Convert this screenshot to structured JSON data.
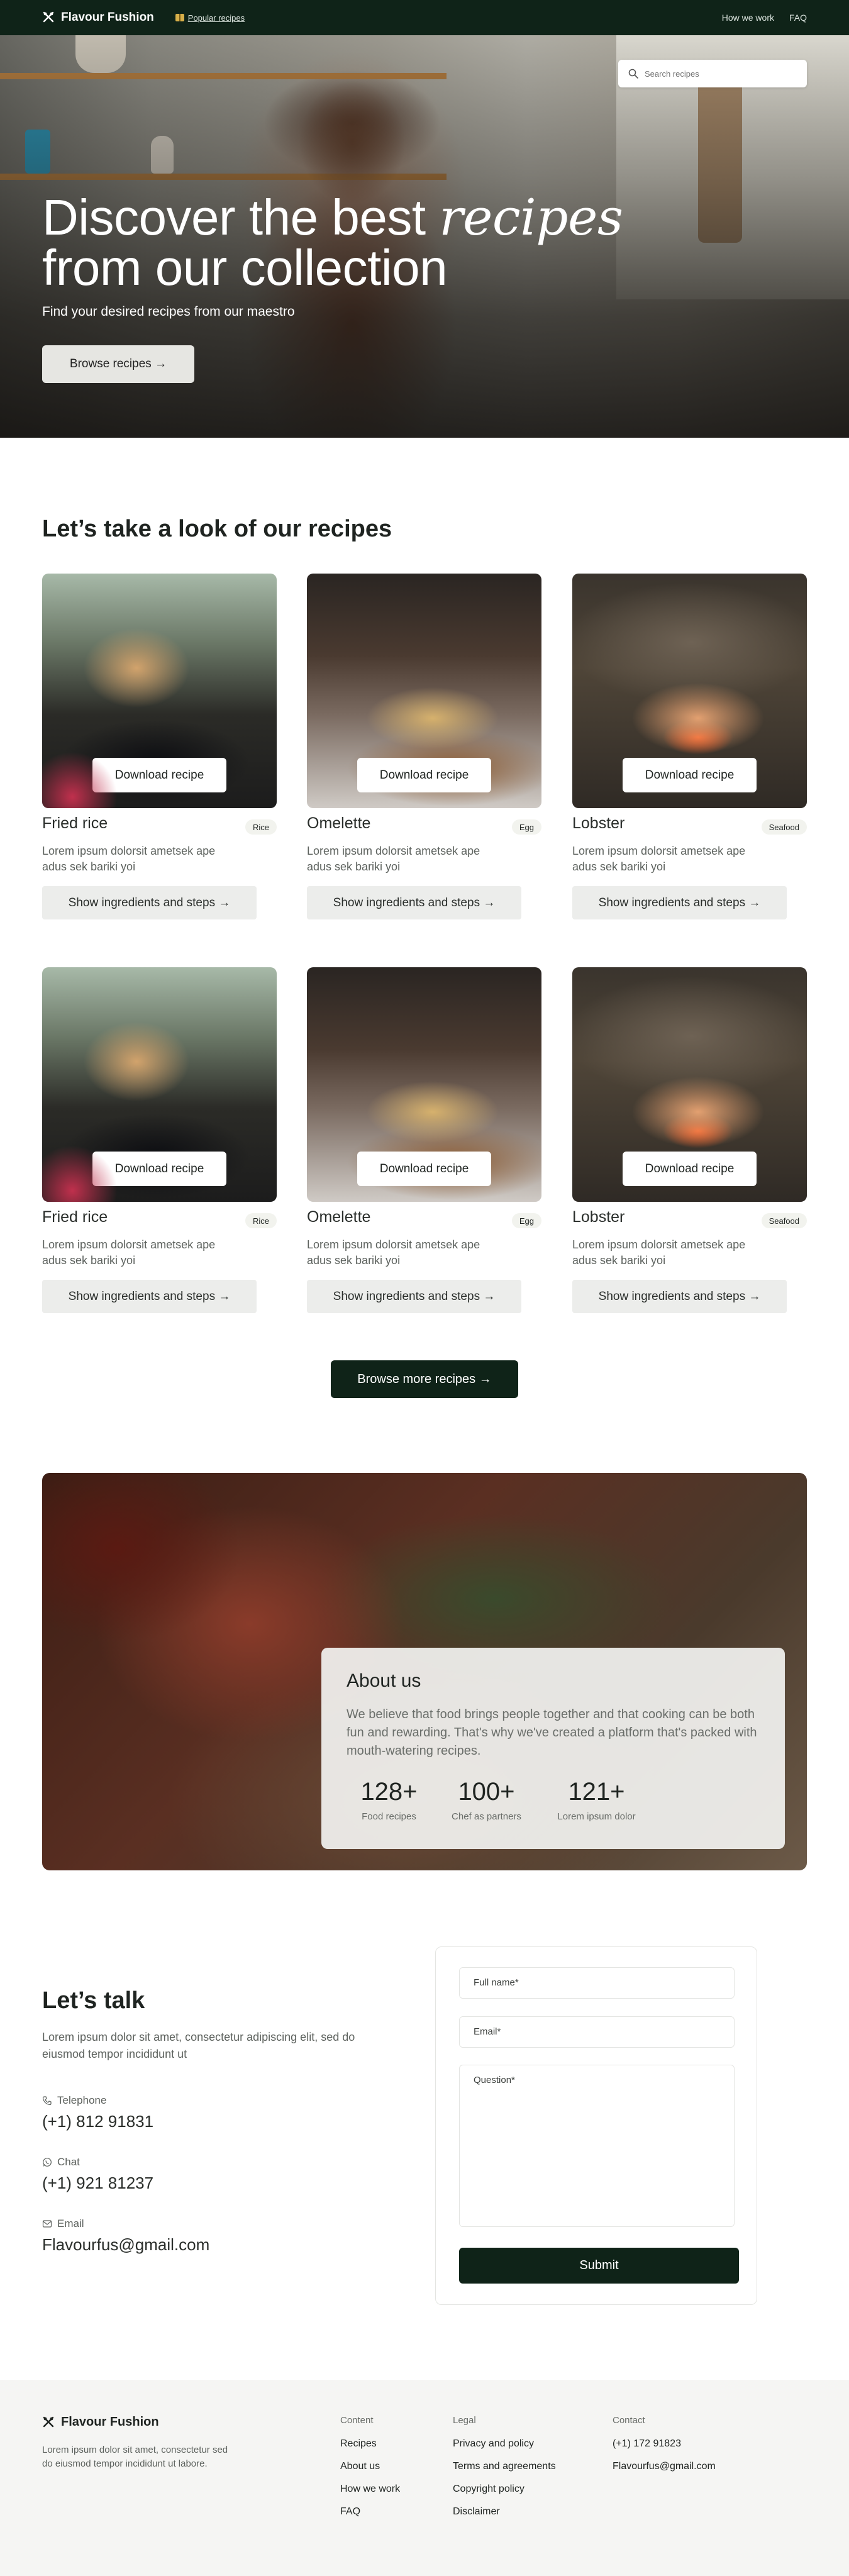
{
  "nav": {
    "brand": "Flavour Fushion",
    "popular": "Popular recipes",
    "links": [
      "How we work",
      "FAQ"
    ]
  },
  "hero": {
    "title_line1_plain": "Discover the best ",
    "title_line1_italic": "recipes",
    "title_line2": "from our collection",
    "subtitle": "Find your desired recipes from our maestro",
    "browse_button": "Browse recipes →",
    "search_placeholder": "Search recipes"
  },
  "recipes": {
    "section_title": "Let’s take a look of our recipes",
    "download_label": "Download recipe",
    "steps_label": "Show ingredients and steps →",
    "cards": [
      {
        "name": "Fried rice",
        "tag": "Rice",
        "desc": "Lorem ipsum dolorsit ametsek ape adus sek bariki yoi",
        "image": "fried-rice"
      },
      {
        "name": "Omelette",
        "tag": "Egg",
        "desc": "Lorem ipsum dolorsit ametsek ape adus sek bariki yoi",
        "image": "omelette"
      },
      {
        "name": "Lobster",
        "tag": "Seafood",
        "desc": "Lorem ipsum dolorsit ametsek ape adus sek bariki yoi",
        "image": "lobster"
      },
      {
        "name": "Fried rice",
        "tag": "Rice",
        "desc": "Lorem ipsum dolorsit ametsek ape adus sek bariki yoi",
        "image": "fried-rice"
      },
      {
        "name": "Omelette",
        "tag": "Egg",
        "desc": "Lorem ipsum dolorsit ametsek ape adus sek bariki yoi",
        "image": "omelette"
      },
      {
        "name": "Lobster",
        "tag": "Seafood",
        "desc": "Lorem ipsum dolorsit ametsek ape adus sek bariki yoi",
        "image": "lobster"
      }
    ],
    "more_button": "Browse more recipes →"
  },
  "about": {
    "title": "About us",
    "text": "We believe that food brings people together and that cooking can be both fun and rewarding. That's why we've created a platform that's packed with mouth-watering recipes.",
    "stats": [
      {
        "value": "128+",
        "label": "Food recipes"
      },
      {
        "value": "100+",
        "label": "Chef as partners"
      },
      {
        "value": "121+",
        "label": "Lorem ipsum dolor"
      }
    ]
  },
  "contact": {
    "title": "Let’s talk",
    "text": "Lorem ipsum dolor sit amet, consectetur adipiscing elit, sed do eiusmod tempor incididunt ut",
    "items": [
      {
        "label": "Telephone",
        "value": "(+1) 812 91831",
        "icon": "phone-icon"
      },
      {
        "label": "Chat",
        "value": "(+1) 921 81237",
        "icon": "whatsapp-icon"
      },
      {
        "label": "Email",
        "value": "Flavourfus@gmail.com",
        "icon": "mail-icon"
      }
    ],
    "form": {
      "name_placeholder": "Full name*",
      "email_placeholder": "Email*",
      "question_placeholder": "Question*",
      "submit": "Submit"
    }
  },
  "footer": {
    "brand": "Flavour Fushion",
    "desc": "Lorem ipsum dolor sit amet, consectetur sed do eiusmod tempor incididunt ut labore.",
    "columns": [
      {
        "title": "Content",
        "items": [
          "Recipes",
          "About us",
          "How we work",
          "FAQ"
        ]
      },
      {
        "title": "Legal",
        "items": [
          "Privacy and policy",
          "Terms and agreements",
          "Copyright policy",
          "Disclaimer"
        ]
      },
      {
        "title": "Contact",
        "items": [
          "(+1) 172 91823",
          "Flavourfus@gmail.com"
        ]
      }
    ]
  },
  "colors": {
    "primary": "#0f2318",
    "accent_text": "#1f2421"
  }
}
